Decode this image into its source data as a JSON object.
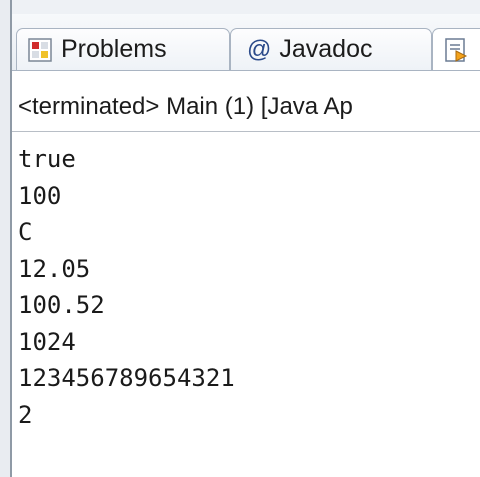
{
  "tabs": [
    {
      "label": "Problems",
      "icon": "problems-icon"
    },
    {
      "label": "Javadoc",
      "icon": "at-icon",
      "glyph": "@"
    },
    {
      "label": "",
      "icon": "declaration-icon"
    }
  ],
  "console": {
    "status": "<terminated> Main (1) [Java Ap",
    "lines": [
      "true",
      "100",
      "C",
      "12.05",
      "100.52",
      "1024",
      "123456789654321",
      "2"
    ]
  },
  "colors": {
    "tab_border": "#a9b4c2",
    "background": "#ffffff"
  }
}
